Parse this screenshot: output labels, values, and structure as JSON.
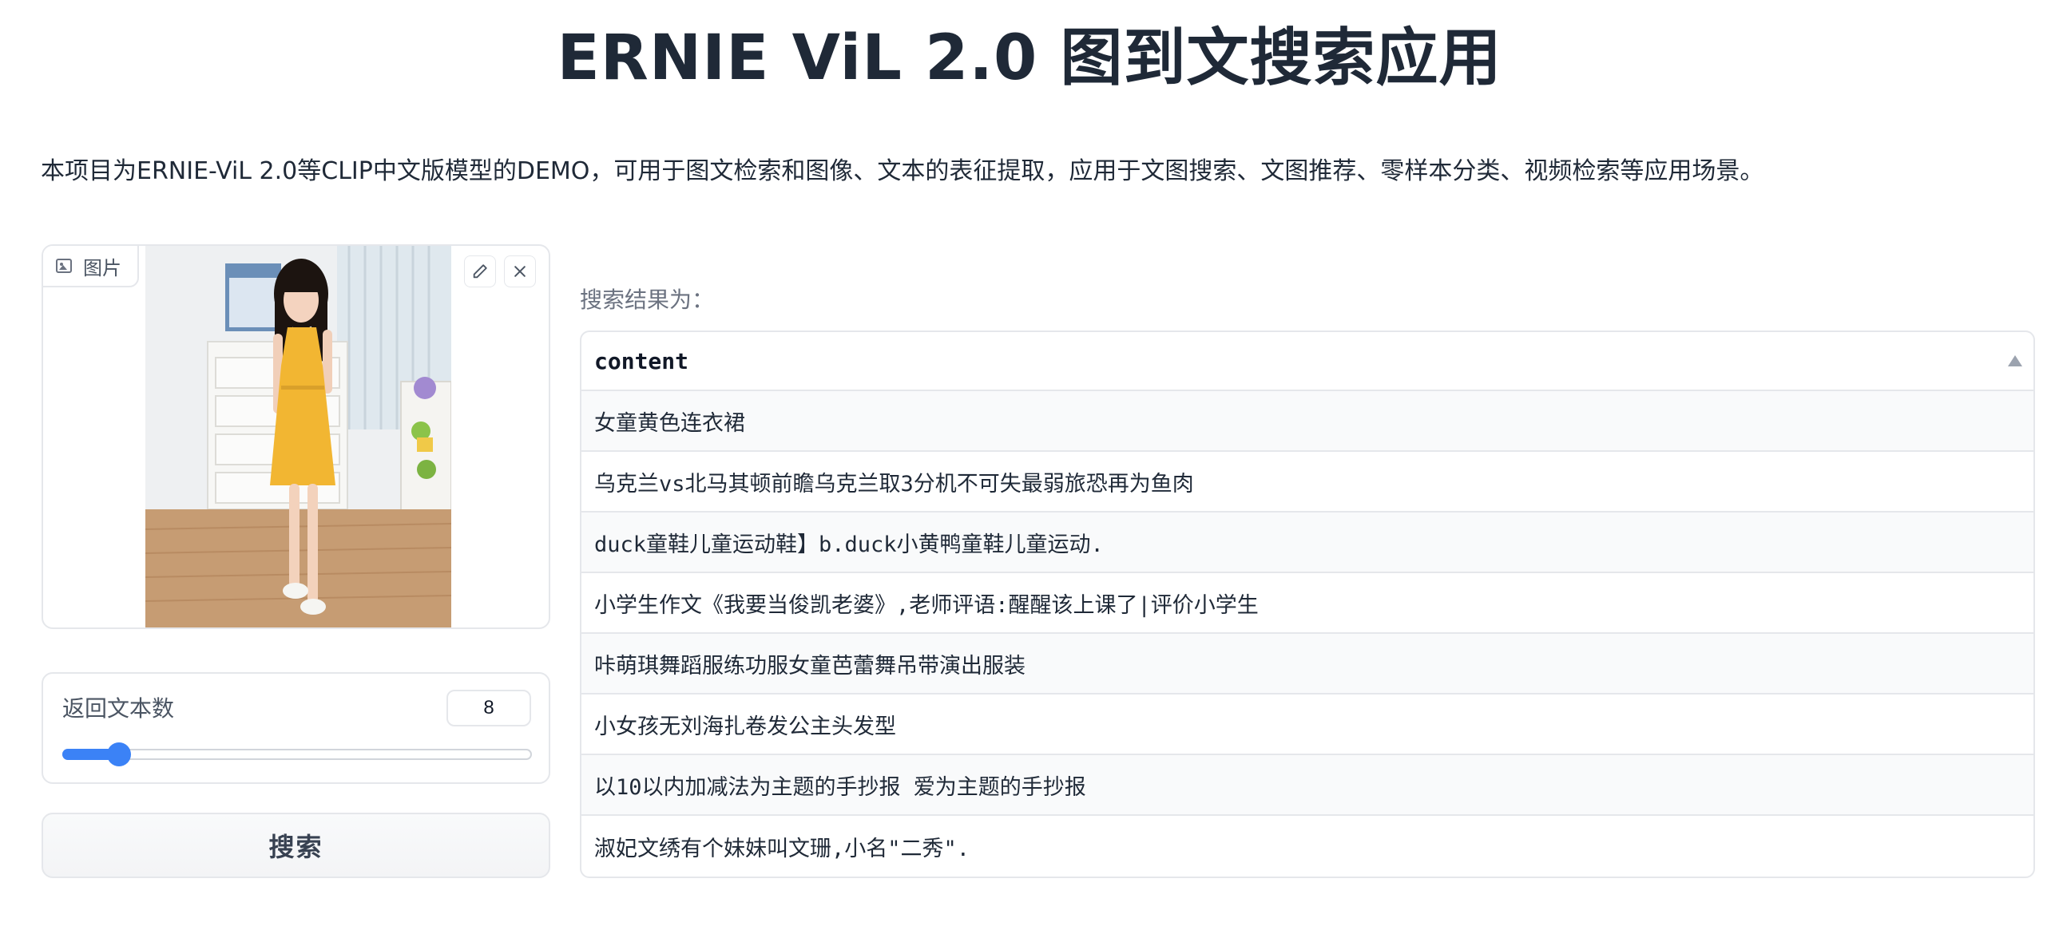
{
  "header": {
    "title": "ERNIE ViL 2.0 图到文搜索应用",
    "description": "本项目为ERNIE-ViL 2.0等CLIP中文版模型的DEMO，可用于图文检索和图像、文本的表征提取，应用于文图搜索、文图推荐、零样本分类、视频检索等应用场景。"
  },
  "image_input": {
    "label": "图片",
    "label_icon": "image-icon",
    "tools": [
      "edit-icon",
      "close-icon"
    ]
  },
  "slider": {
    "label": "返回文本数",
    "value": "8",
    "fraction": 0.1
  },
  "search_button": "搜索",
  "results": {
    "label": "搜索结果为：",
    "column": "content",
    "rows": [
      "女童黄色连衣裙",
      "乌克兰vs北马其顿前瞻乌克兰取3分机不可失最弱旅恐再为鱼肉",
      "duck童鞋儿童运动鞋】b.duck小黄鸭童鞋儿童运动.",
      "小学生作文《我要当俊凯老婆》,老师评语:醒醒该上课了|评价小学生",
      "咔萌琪舞蹈服练功服女童芭蕾舞吊带演出服装",
      "小女孩无刘海扎卷发公主头发型",
      "以10以内加减法为主题的手抄报 爱为主题的手抄报",
      "淑妃文绣有个妹妹叫文珊,小名\"二秀\"."
    ]
  },
  "colors": {
    "accent": "#3b82f6",
    "border": "#e5e7eb",
    "dress": "#f2b632"
  }
}
